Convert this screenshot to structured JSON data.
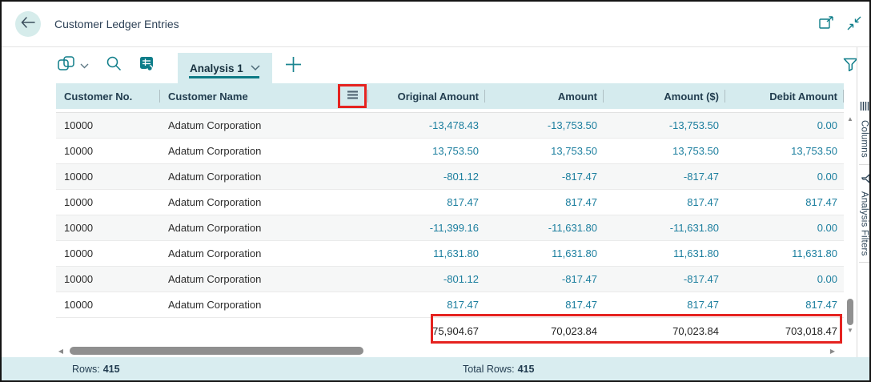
{
  "window": {
    "title": "Customer Ledger Entries"
  },
  "toolbar": {
    "active_tab": "Analysis 1"
  },
  "table": {
    "columns": {
      "customer_no": "Customer No.",
      "customer_name": "Customer Name",
      "original_amount": "Original Amount",
      "amount": "Amount",
      "amount_usd": "Amount ($)",
      "debit_amount": "Debit Amount"
    },
    "rows": [
      {
        "customer_no": "10000",
        "customer_name": "Adatum Corporation",
        "original_amount": "-13,478.43",
        "amount": "-13,753.50",
        "amount_usd": "-13,753.50",
        "debit_amount": "0.00"
      },
      {
        "customer_no": "10000",
        "customer_name": "Adatum Corporation",
        "original_amount": "13,753.50",
        "amount": "13,753.50",
        "amount_usd": "13,753.50",
        "debit_amount": "13,753.50"
      },
      {
        "customer_no": "10000",
        "customer_name": "Adatum Corporation",
        "original_amount": "-801.12",
        "amount": "-817.47",
        "amount_usd": "-817.47",
        "debit_amount": "0.00"
      },
      {
        "customer_no": "10000",
        "customer_name": "Adatum Corporation",
        "original_amount": "817.47",
        "amount": "817.47",
        "amount_usd": "817.47",
        "debit_amount": "817.47"
      },
      {
        "customer_no": "10000",
        "customer_name": "Adatum Corporation",
        "original_amount": "-11,399.16",
        "amount": "-11,631.80",
        "amount_usd": "-11,631.80",
        "debit_amount": "0.00"
      },
      {
        "customer_no": "10000",
        "customer_name": "Adatum Corporation",
        "original_amount": "11,631.80",
        "amount": "11,631.80",
        "amount_usd": "11,631.80",
        "debit_amount": "11,631.80"
      },
      {
        "customer_no": "10000",
        "customer_name": "Adatum Corporation",
        "original_amount": "-801.12",
        "amount": "-817.47",
        "amount_usd": "-817.47",
        "debit_amount": "0.00"
      },
      {
        "customer_no": "10000",
        "customer_name": "Adatum Corporation",
        "original_amount": "817.47",
        "amount": "817.47",
        "amount_usd": "817.47",
        "debit_amount": "817.47"
      }
    ],
    "totals": {
      "original_amount": "75,904.67",
      "amount": "70,023.84",
      "amount_usd": "70,023.84",
      "debit_amount": "703,018.47"
    }
  },
  "side_panel": {
    "columns_label": "Columns",
    "filters_label": "Analysis Filters"
  },
  "status_bar": {
    "rows_label": "Rows:",
    "rows_value": "415",
    "total_rows_label": "Total Rows:",
    "total_rows_value": "415"
  },
  "glyphs": {
    "scroll_up": "▲",
    "scroll_down": "▼",
    "scroll_left": "◀",
    "scroll_right": "▶"
  },
  "colors": {
    "accent_teal": "#0e7d89",
    "amount_link_teal": "#1b7e9e",
    "header_band": "#d5ebee",
    "status_bar_bg": "#d9edf0",
    "annotation_red": "#e52320"
  }
}
